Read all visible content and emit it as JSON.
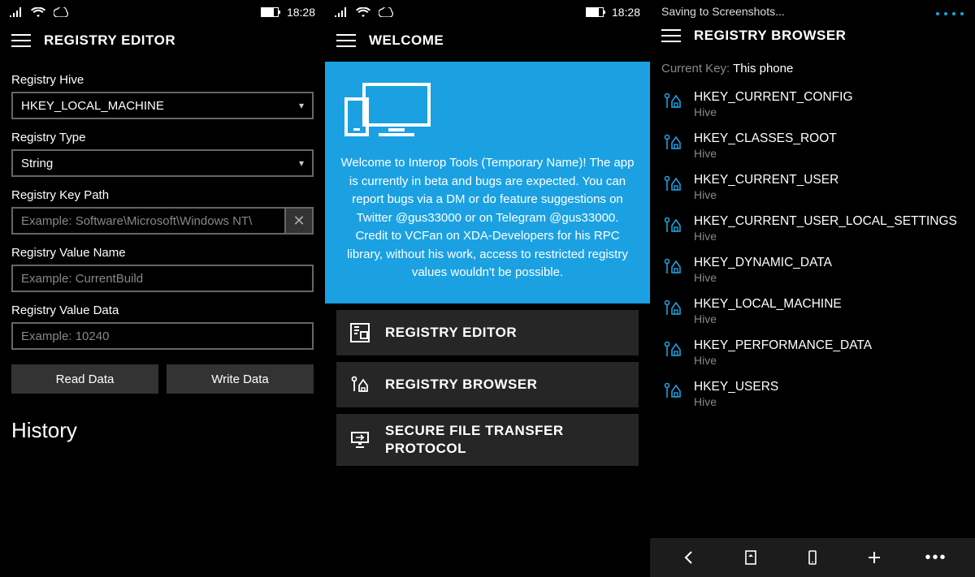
{
  "status": {
    "time": "18:28"
  },
  "editor": {
    "title": "REGISTRY EDITOR",
    "labels": {
      "hive": "Registry Hive",
      "type": "Registry Type",
      "keypath": "Registry Key Path",
      "valuename": "Registry Value Name",
      "valuedata": "Registry Value Data"
    },
    "values": {
      "hive": "HKEY_LOCAL_MACHINE",
      "type": "String"
    },
    "placeholders": {
      "keypath": "Example: Software\\Microsoft\\Windows NT\\",
      "valuename": "Example: CurrentBuild",
      "valuedata": "Example: 10240"
    },
    "buttons": {
      "read": "Read Data",
      "write": "Write Data"
    },
    "history": "History"
  },
  "welcome": {
    "title": "WELCOME",
    "hero_text": "Welcome to Interop Tools (Temporary Name)! The app is currently in beta and bugs are expected. You can report bugs via a DM or do feature suggestions on Twitter @gus33000 or on Telegram @gus33000. Credit to VCFan on XDA-Developers for his RPC library, without his work, access to restricted registry values wouldn't be possible.",
    "nav": {
      "editor": "REGISTRY EDITOR",
      "browser": "REGISTRY BROWSER",
      "sftp": "SECURE FILE TRANSFER PROTOCOL"
    }
  },
  "browser": {
    "saving": "Saving to Screenshots...",
    "title": "REGISTRY BROWSER",
    "current_key_label": "Current Key: ",
    "current_key_value": "This phone",
    "hive_type": "Hive",
    "hives": [
      "HKEY_CURRENT_CONFIG",
      "HKEY_CLASSES_ROOT",
      "HKEY_CURRENT_USER",
      "HKEY_CURRENT_USER_LOCAL_SETTINGS",
      "HKEY_DYNAMIC_DATA",
      "HKEY_LOCAL_MACHINE",
      "HKEY_PERFORMANCE_DATA",
      "HKEY_USERS"
    ]
  },
  "colors": {
    "accent": "#1ba1e2"
  }
}
